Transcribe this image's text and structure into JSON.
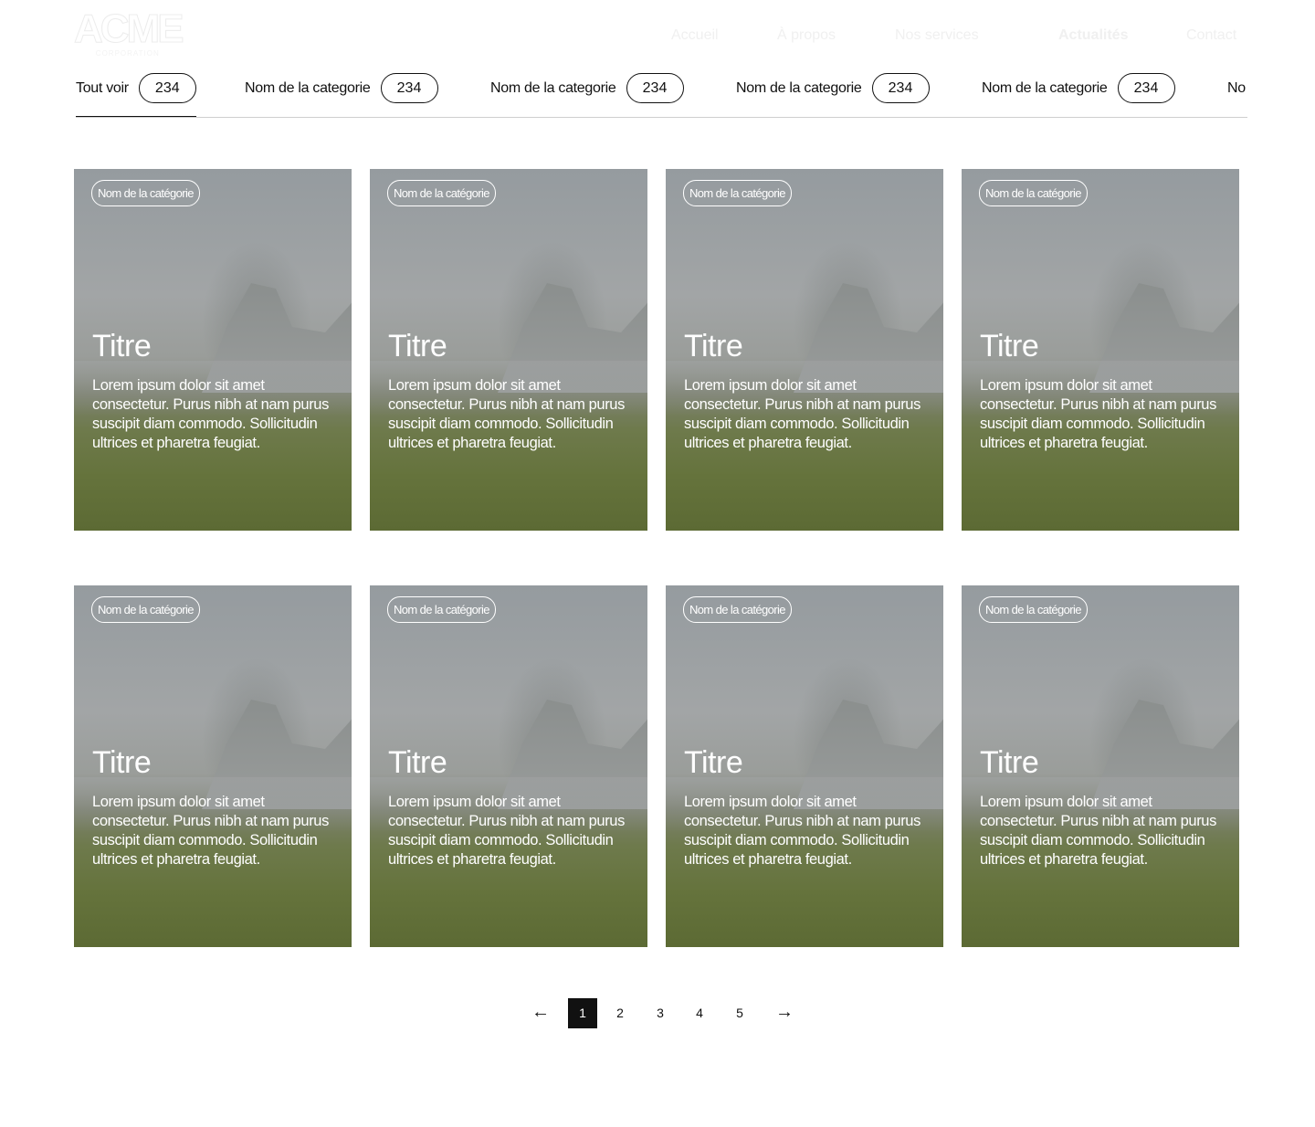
{
  "header": {
    "logo_text": "ACME",
    "logo_sub": "CORPORATION",
    "nav": [
      {
        "label": "Accueil"
      },
      {
        "label": "À propos"
      },
      {
        "label": "Nos services"
      },
      {
        "label": "Actualités"
      },
      {
        "label": "Contact"
      }
    ]
  },
  "tabs": [
    {
      "label": "Tout voir",
      "count": "234",
      "active": true
    },
    {
      "label": "Nom de la categorie",
      "count": "234"
    },
    {
      "label": "Nom de la categorie",
      "count": "234"
    },
    {
      "label": "Nom de la categorie",
      "count": "234"
    },
    {
      "label": "Nom de la categorie",
      "count": "234"
    },
    {
      "label": "No",
      "count": ""
    }
  ],
  "cards": [
    {
      "category": "Nom de la catégorie",
      "title": "Titre",
      "text": "Lorem ipsum dolor sit amet consectetur. Purus nibh at nam purus suscipit diam commodo. Sollicitudin ultrices et pharetra feugiat."
    },
    {
      "category": "Nom de la catégorie",
      "title": "Titre",
      "text": "Lorem ipsum dolor sit amet consectetur. Purus nibh at nam purus suscipit diam commodo. Sollicitudin ultrices et pharetra feugiat."
    },
    {
      "category": "Nom de la catégorie",
      "title": "Titre",
      "text": "Lorem ipsum dolor sit amet consectetur. Purus nibh at nam purus suscipit diam commodo. Sollicitudin ultrices et pharetra feugiat."
    },
    {
      "category": "Nom de la catégorie",
      "title": "Titre",
      "text": "Lorem ipsum dolor sit amet consectetur. Purus nibh at nam purus suscipit diam commodo. Sollicitudin ultrices et pharetra feugiat."
    },
    {
      "category": "Nom de la catégorie",
      "title": "Titre",
      "text": "Lorem ipsum dolor sit amet consectetur. Purus nibh at nam purus suscipit diam commodo. Sollicitudin ultrices et pharetra feugiat."
    },
    {
      "category": "Nom de la catégorie",
      "title": "Titre",
      "text": "Lorem ipsum dolor sit amet consectetur. Purus nibh at nam purus suscipit diam commodo. Sollicitudin ultrices et pharetra feugiat."
    },
    {
      "category": "Nom de la catégorie",
      "title": "Titre",
      "text": "Lorem ipsum dolor sit amet consectetur. Purus nibh at nam purus suscipit diam commodo. Sollicitudin ultrices et pharetra feugiat."
    },
    {
      "category": "Nom de la catégorie",
      "title": "Titre",
      "text": "Lorem ipsum dolor sit amet consectetur. Purus nibh at nam purus suscipit diam commodo. Sollicitudin ultrices et pharetra feugiat."
    }
  ],
  "pagination": {
    "pages": [
      "1",
      "2",
      "3",
      "4",
      "5"
    ],
    "current": "1",
    "prev_icon": "arrow-left-icon",
    "next_icon": "arrow-right-icon"
  }
}
